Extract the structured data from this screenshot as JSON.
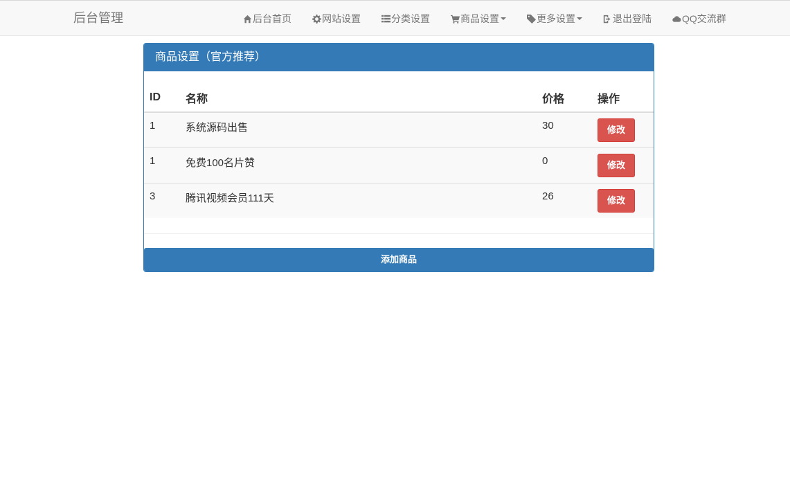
{
  "navbar": {
    "brand": "后台管理",
    "items": [
      {
        "label": "后台首页",
        "icon": "home-icon"
      },
      {
        "label": "网站设置",
        "icon": "gear-icon"
      },
      {
        "label": "分类设置",
        "icon": "list-icon"
      },
      {
        "label": "商品设置",
        "icon": "cart-icon",
        "dropdown": true
      },
      {
        "label": "更多设置",
        "icon": "tag-icon",
        "dropdown": true
      },
      {
        "label": "退出登陆",
        "icon": "logout-icon"
      },
      {
        "label": "QQ交流群",
        "icon": "cloud-icon"
      }
    ]
  },
  "panel": {
    "title": "商品设置（官方推荐）",
    "table": {
      "headers": {
        "id": "ID",
        "name": "名称",
        "price": "价格",
        "action": "操作"
      },
      "rows": [
        {
          "id": "1",
          "name": "系统源码出售",
          "price": "30",
          "action": "修改"
        },
        {
          "id": "1",
          "name": "免费100名片赞",
          "price": "0",
          "action": "修改"
        },
        {
          "id": "3",
          "name": "腾讯视频会员111天",
          "price": "26",
          "action": "修改"
        }
      ]
    },
    "add_button": "添加商品"
  },
  "colors": {
    "primary": "#337ab7",
    "danger": "#d9534f",
    "navbar_bg": "#f8f8f8"
  }
}
